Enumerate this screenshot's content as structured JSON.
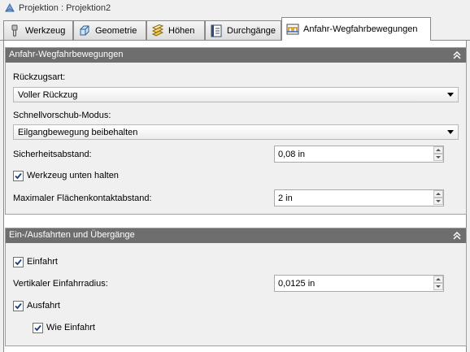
{
  "window": {
    "title": "Projektion : Projektion2",
    "icon": "projection-icon"
  },
  "tabs": [
    {
      "label": "Werkzeug",
      "icon": "tool-icon",
      "active": false
    },
    {
      "label": "Geometrie",
      "icon": "geometry-icon",
      "active": false
    },
    {
      "label": "Höhen",
      "icon": "heights-icon",
      "active": false
    },
    {
      "label": "Durchgänge",
      "icon": "passes-icon",
      "active": false
    },
    {
      "label": "Anfahr-Wegfahrbewegungen",
      "icon": "linking-icon",
      "active": true
    }
  ],
  "panel1": {
    "title": "Anfahr-Wegfahrbewegungen",
    "retract_label": "Rückzugsart:",
    "retract_value": "Voller Rückzug",
    "rapid_label": "Schnellvorschub-Modus:",
    "rapid_value": "Eilgangbewegung beibehalten",
    "clearance_label": "Sicherheitsabstand:",
    "clearance_value": "0,08 in",
    "keep_tool_down_label": "Werkzeug unten halten",
    "keep_tool_down_checked": true,
    "max_stay_down_label": "Maximaler Flächenkontaktabstand:",
    "max_stay_down_value": "2 in"
  },
  "panel2": {
    "title": "Ein-/Ausfahrten und Übergänge",
    "lead_in_label": "Einfahrt",
    "lead_in_checked": true,
    "vertical_radius_label": "Vertikaler Einfahrradius:",
    "vertical_radius_value": "0,0125 in",
    "lead_out_label": "Ausfahrt",
    "lead_out_checked": true,
    "same_as_lead_in_label": "Wie Einfahrt",
    "same_as_lead_in_checked": true
  }
}
